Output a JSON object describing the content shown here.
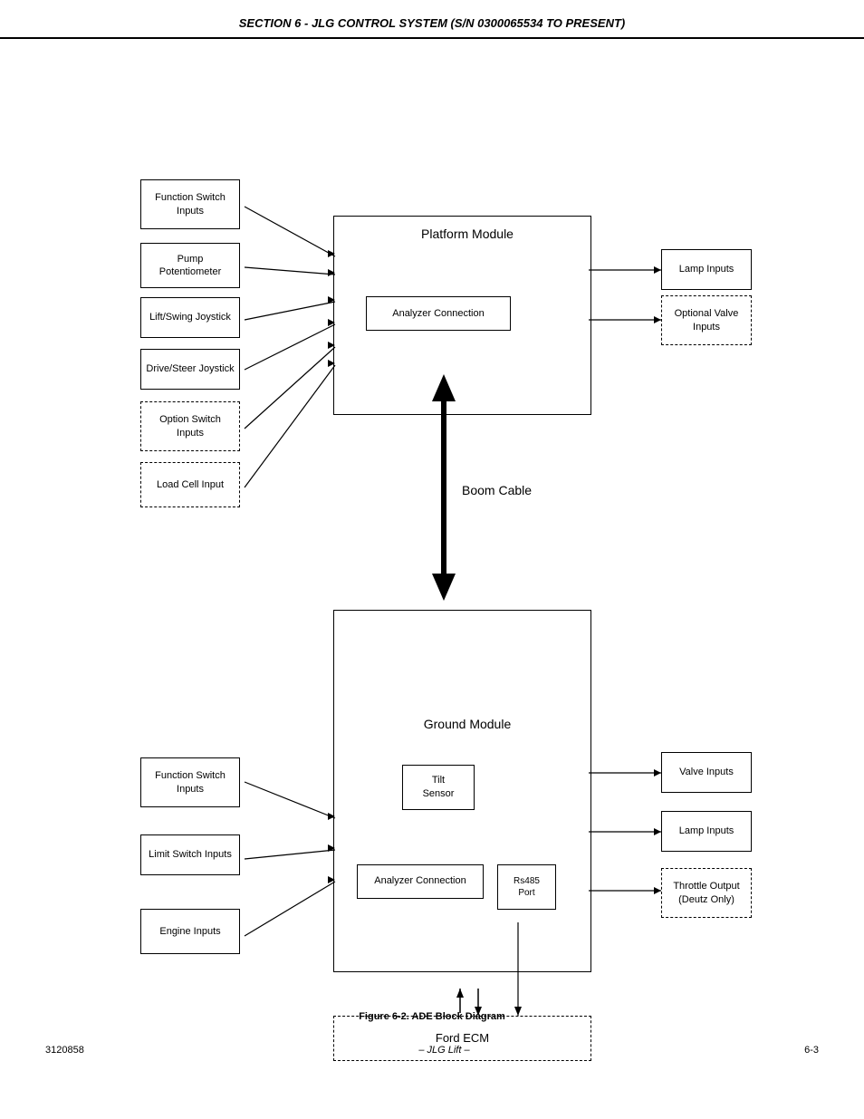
{
  "header": {
    "title": "SECTION 6 - JLG CONTROL SYSTEM (S/N 0300065534 TO PRESENT)"
  },
  "footer": {
    "left": "3120858",
    "center": "– JLG Lift –",
    "right": "6-3"
  },
  "figure_caption": "Figure 6-2.  ADE Block Diagram",
  "boxes": {
    "platform_module": "Platform Module",
    "ground_module": "Ground Module",
    "analyzer_connection_top": "Analyzer Connection",
    "analyzer_connection_bottom": "Analyzer Connection",
    "boom_cable": "Boom Cable",
    "ford_ecm": "Ford ECM",
    "tilt_sensor": "Tilt\nSensor",
    "rs485_port": "Rs485\nPort",
    "func_switch_top": "Function Switch\nInputs",
    "pump_pot": "Pump\nPotentiometer",
    "lift_swing": "Lift/Swing Joystick",
    "drive_steer": "Drive/Steer Joystick",
    "option_switch": "Option Switch\nInputs",
    "load_cell": "Load Cell Input",
    "lamp_inputs_top": "Lamp Inputs",
    "optional_valve": "Optional Valve\nInputs",
    "func_switch_bottom": "Function Switch\nInputs",
    "limit_switch": "Limit Switch Inputs",
    "engine_inputs": "Engine Inputs",
    "valve_inputs": "Valve Inputs",
    "lamp_inputs_bottom": "Lamp Inputs",
    "throttle_output": "Throttle Output\n(Deutz Only)"
  }
}
